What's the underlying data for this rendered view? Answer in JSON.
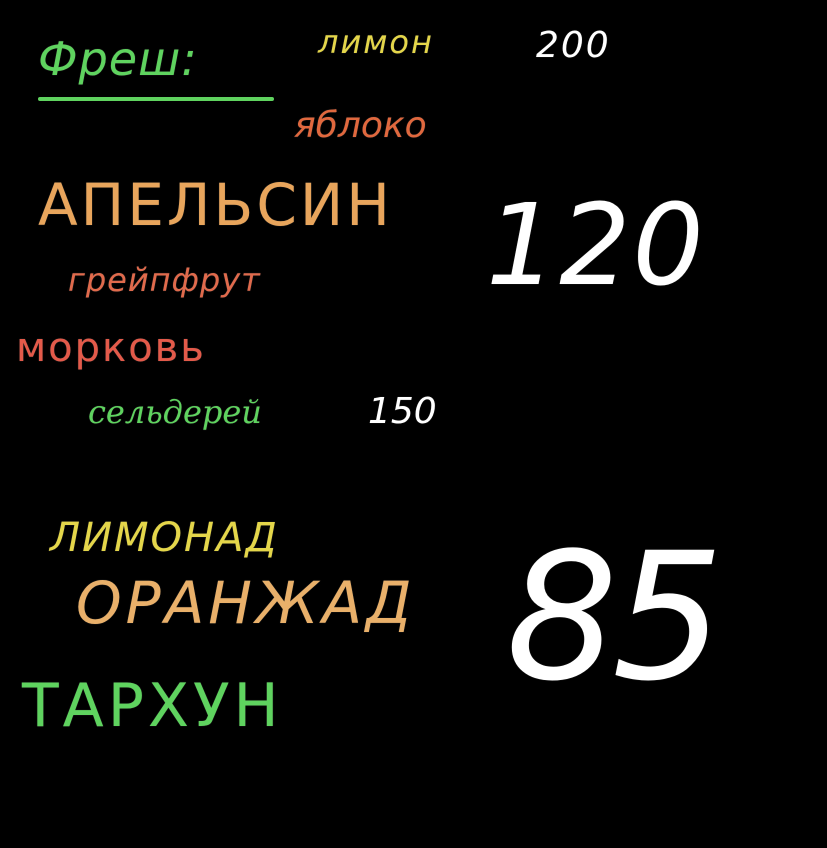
{
  "colors": {
    "background": "#000000",
    "green": "#5fd35f",
    "yellow": "#e4d64a",
    "orange_red": "#e0683e",
    "orange": "#e8a55c",
    "salmon": "#e06a4c",
    "red": "#e35a4a",
    "white": "#ffffff",
    "light_orange": "#e9b06a"
  },
  "title": "Фреш:",
  "fresh": {
    "items": [
      {
        "name": "лимон"
      },
      {
        "name": "яблоко"
      },
      {
        "name": "АПЕЛЬСИН"
      },
      {
        "name": "грейпфрут"
      },
      {
        "name": "морковь"
      },
      {
        "name": "сельдерей"
      }
    ],
    "lemon_price": "200",
    "celery_price": "150",
    "price": "120"
  },
  "lemonade": {
    "items": [
      {
        "name": "ЛИМОНАД"
      },
      {
        "name": "ОРАНЖАД"
      },
      {
        "name": "ТАРХУН"
      }
    ],
    "price": "85"
  }
}
